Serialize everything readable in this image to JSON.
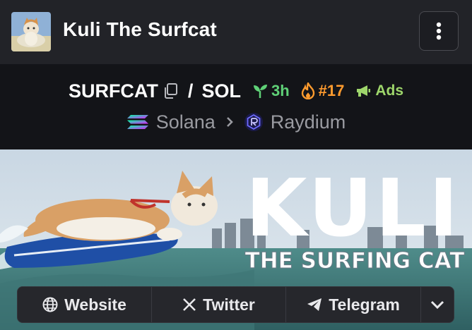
{
  "header": {
    "token_name": "Kuli The Surfcat",
    "avatar_icon": "cat-avatar",
    "menu_icon": "vertical-dots-icon"
  },
  "pair": {
    "base_symbol": "SURFCAT",
    "separator": "/",
    "quote_symbol": "SOL",
    "age": "3h",
    "rank": "#17",
    "ads_label": "Ads"
  },
  "chain": {
    "chain_name": "Solana",
    "dex_name": "Raydium"
  },
  "banner": {
    "title": "KULI",
    "subtitle": "THE SURFING CAT"
  },
  "links": {
    "website": "Website",
    "twitter": "Twitter",
    "telegram": "Telegram"
  },
  "colors": {
    "age": "#5fd177",
    "rank": "#ff9b2e",
    "ads": "#9ed66b",
    "header_bg": "#222328",
    "page_bg": "#131418"
  }
}
